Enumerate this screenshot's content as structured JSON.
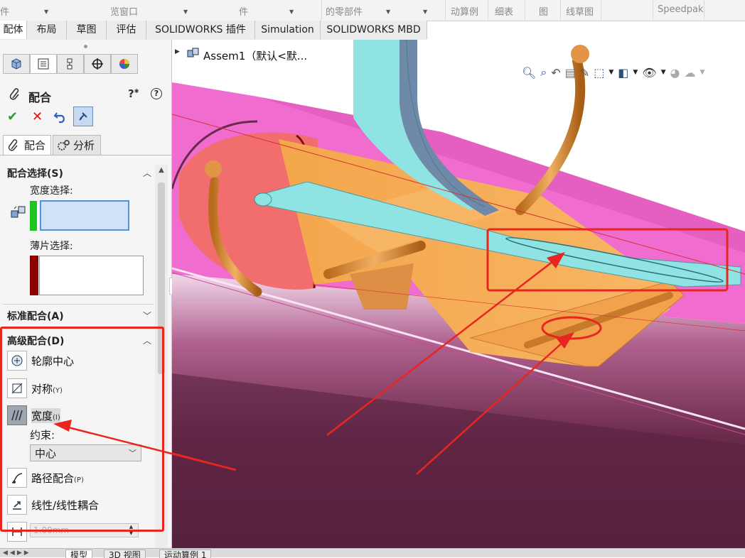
{
  "ribbon": {
    "items": [
      "件",
      "览窗口",
      "件",
      "的零部件",
      "动算例",
      "细表",
      "图",
      "线草图",
      "Speedpak"
    ]
  },
  "tabs": [
    "配体",
    "布局",
    "草图",
    "评估",
    "SOLIDWORKS 插件",
    "Simulation",
    "SOLIDWORKS MBD"
  ],
  "tree": {
    "root_label": "Assem1（默认<默..."
  },
  "panel": {
    "title": "配合",
    "subtabs": {
      "mates": "配合",
      "analysis": "分析"
    },
    "mate_selection": {
      "header": "配合选择(S)",
      "width_label": "宽度选择:",
      "tab_label": "薄片选择:"
    },
    "standard_header": "标准配合(A)",
    "advanced": {
      "header": "高级配合(D)",
      "profile_center": "轮廓中心",
      "symmetric": "对称",
      "symmetric_key": "(Y)",
      "width": "宽度",
      "width_key": "(I)",
      "constraint_label": "约束:",
      "constraint_value": "中心",
      "path_mate": "路径配合",
      "path_key": "(P)",
      "linear_coupler": "线性/线性耦合",
      "distance_value": "1.00mm"
    }
  },
  "bottom_tabs": [
    "模型",
    "3D 视图",
    "运动算例 1"
  ],
  "colors": {
    "annotation": "#e8261f",
    "body_pink": "#f06ccf",
    "body_dark": "#6a2a4a",
    "orange": "#f2a24d",
    "cyan": "#8fe3e3",
    "selection_blue": "#cfe2f7"
  }
}
